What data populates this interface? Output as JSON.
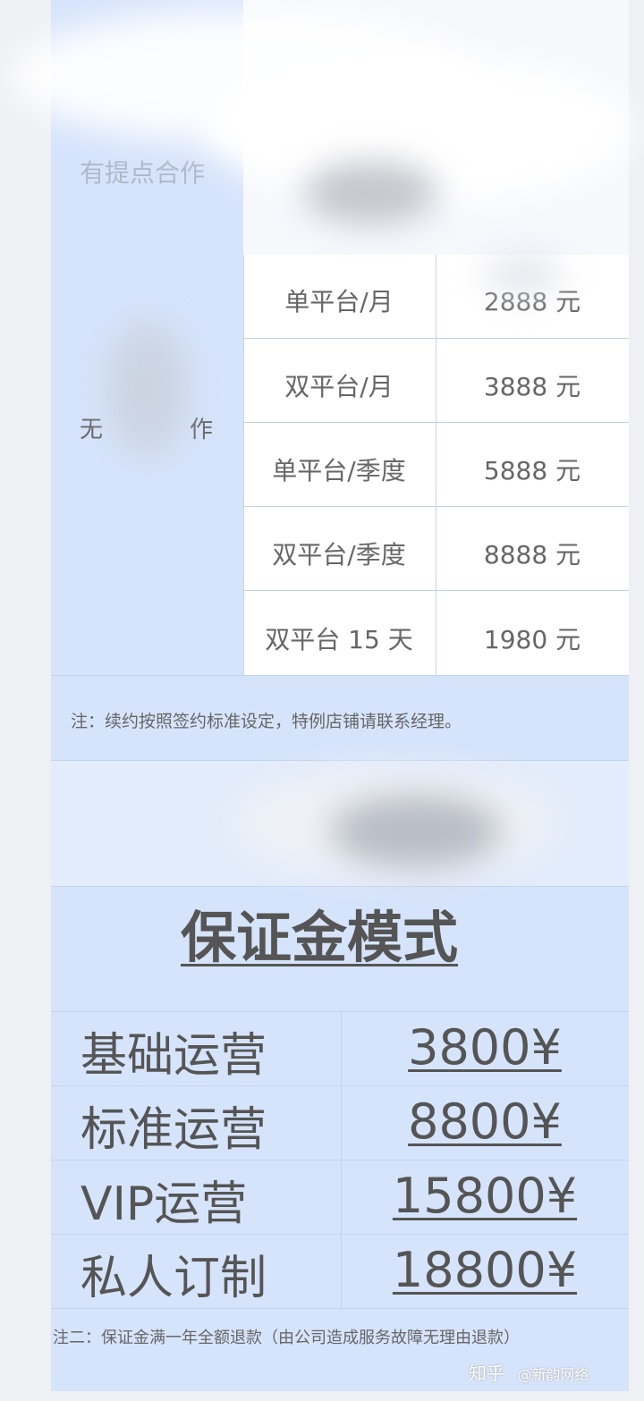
{
  "sheet": {
    "header_partial": "有提点合作",
    "group_label": "无",
    "group_label_tail": "作"
  },
  "plans": [
    {
      "label": "单平台/月",
      "price": "2888 元"
    },
    {
      "label": "双平台/月",
      "price": "3888 元"
    },
    {
      "label": "单平台/季度",
      "price": "5888 元"
    },
    {
      "label": "双平台/季度",
      "price": "8888 元"
    },
    {
      "label": "双平台 15 天",
      "price": "1980 元"
    }
  ],
  "note1": "注：续约按照签约标准设定，特例店铺请联系经理。",
  "deposit": {
    "title": "保证金模式",
    "rows": [
      {
        "label": "基础运营",
        "price": "3800¥"
      },
      {
        "label": "标准运营",
        "price": "8800¥"
      },
      {
        "label": "VIP运营",
        "price": "15800¥"
      },
      {
        "label": "私人订制",
        "price": "18800¥"
      }
    ]
  },
  "note2": "注二：保证金满一年全额退款（由公司造成服务故障无理由退款）",
  "watermark": {
    "site": "知乎",
    "handle": "@新韵网络"
  },
  "colors": {
    "sheet_bg": "#d6e4fb",
    "cell_bg": "#ffffff",
    "grid_line": "#c2d3ee",
    "text": "#555555"
  }
}
